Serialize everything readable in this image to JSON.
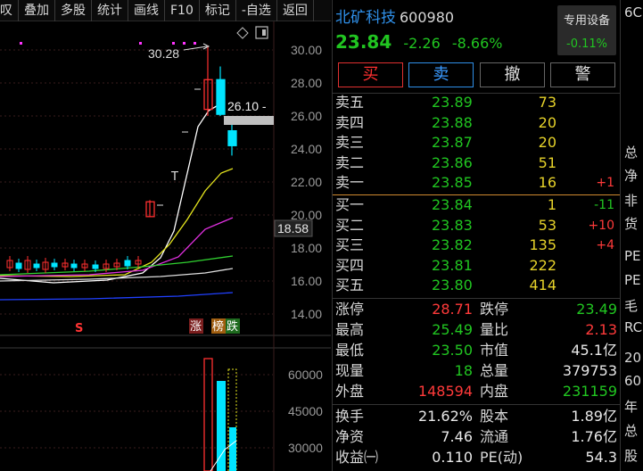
{
  "toolbar": {
    "items": [
      "叹",
      "叠加",
      "多股",
      "统计",
      "画线",
      "F10",
      "标记",
      "-自选",
      "返回"
    ]
  },
  "chart": {
    "y_axis_labels": [
      "30.00",
      "28.00",
      "26.00",
      "24.00",
      "22.00",
      "20.00",
      "18.00",
      "16.00",
      "14.00"
    ],
    "high_marker": "30.28",
    "price_marker": "26.10 -",
    "cursor_price": "18.58",
    "volume_axis_labels": [
      "60000",
      "45000",
      "30000"
    ],
    "t_marker": "T",
    "signal_tags": [
      "涨",
      "榜",
      "跌"
    ],
    "s_marker": "S",
    "colors": {
      "up": "#ff3030",
      "down": "#00e5ff",
      "ma5": "#ffffff",
      "ma10": "#e6e61e",
      "ma20": "#e030e0",
      "ma60": "#30d030",
      "ma120": "#dddddd",
      "ma250": "#2040ff"
    }
  },
  "chart_data": {
    "type": "candlestick",
    "ylim": [
      13.5,
      30.8
    ],
    "candles": [
      {
        "open": 19.9,
        "high": 20.9,
        "low": 19.9,
        "close": 20.8
      },
      {
        "open": 26.4,
        "high": 30.28,
        "low": 26.0,
        "close": 28.2
      },
      {
        "open": 28.2,
        "high": 29.0,
        "low": 26.0,
        "close": 26.1
      },
      {
        "open": 25.1,
        "high": 25.8,
        "low": 23.6,
        "close": 24.2
      }
    ]
  },
  "quote": {
    "name": "北矿科技",
    "code": "600980",
    "last": "23.84",
    "change": "-2.26",
    "change_pct": "-8.66%",
    "device_label": "专用设备",
    "device_pct": "-0.11%"
  },
  "buttons": {
    "buy": "买",
    "sell": "卖",
    "cancel": "撤",
    "alert": "警"
  },
  "order_book": {
    "asks": [
      {
        "label": "卖五",
        "price": "23.89",
        "vol": "73",
        "delta": ""
      },
      {
        "label": "卖四",
        "price": "23.88",
        "vol": "20",
        "delta": ""
      },
      {
        "label": "卖三",
        "price": "23.87",
        "vol": "20",
        "delta": ""
      },
      {
        "label": "卖二",
        "price": "23.86",
        "vol": "51",
        "delta": ""
      },
      {
        "label": "卖一",
        "price": "23.85",
        "vol": "16",
        "delta": "+1"
      }
    ],
    "bids": [
      {
        "label": "买一",
        "price": "23.84",
        "vol": "1",
        "delta": "-11"
      },
      {
        "label": "买二",
        "price": "23.83",
        "vol": "53",
        "delta": "+10"
      },
      {
        "label": "买三",
        "price": "23.82",
        "vol": "135",
        "delta": "+4"
      },
      {
        "label": "买四",
        "price": "23.81",
        "vol": "222",
        "delta": ""
      },
      {
        "label": "买五",
        "price": "23.80",
        "vol": "414",
        "delta": ""
      }
    ]
  },
  "stats": {
    "rows": [
      {
        "l1": "涨停",
        "v1": "28.71",
        "c1": "red",
        "l2": "跌停",
        "v2": "23.49",
        "c2": "green"
      },
      {
        "l1": "最高",
        "v1": "25.49",
        "c1": "green",
        "l2": "量比",
        "v2": "2.13",
        "c2": "red"
      },
      {
        "l1": "最低",
        "v1": "23.50",
        "c1": "green",
        "l2": "市值",
        "v2": "45.1亿",
        "c2": "white"
      },
      {
        "l1": "现量",
        "v1": "18",
        "c1": "green",
        "l2": "总量",
        "v2": "379753",
        "c2": "white"
      },
      {
        "l1": "外盘",
        "v1": "148594",
        "c1": "red",
        "l2": "内盘",
        "v2": "231159",
        "c2": "green"
      },
      {
        "l1": "换手",
        "v1": "21.62%",
        "c1": "white",
        "l2": "股本",
        "v2": "1.89亿",
        "c2": "white"
      },
      {
        "l1": "净资",
        "v1": "7.46",
        "c1": "white",
        "l2": "流通",
        "v2": "1.76亿",
        "c2": "white"
      },
      {
        "l1": "收益㈠",
        "v1": "0.110",
        "c1": "white",
        "l2": "PE(动)",
        "v2": "54.3",
        "c2": "white"
      }
    ]
  },
  "right_column": [
    "6C",
    "总",
    "净",
    "非",
    "货",
    "PE",
    "PE",
    "毛",
    "RC",
    "20",
    "60",
    "年",
    "总",
    "股"
  ]
}
